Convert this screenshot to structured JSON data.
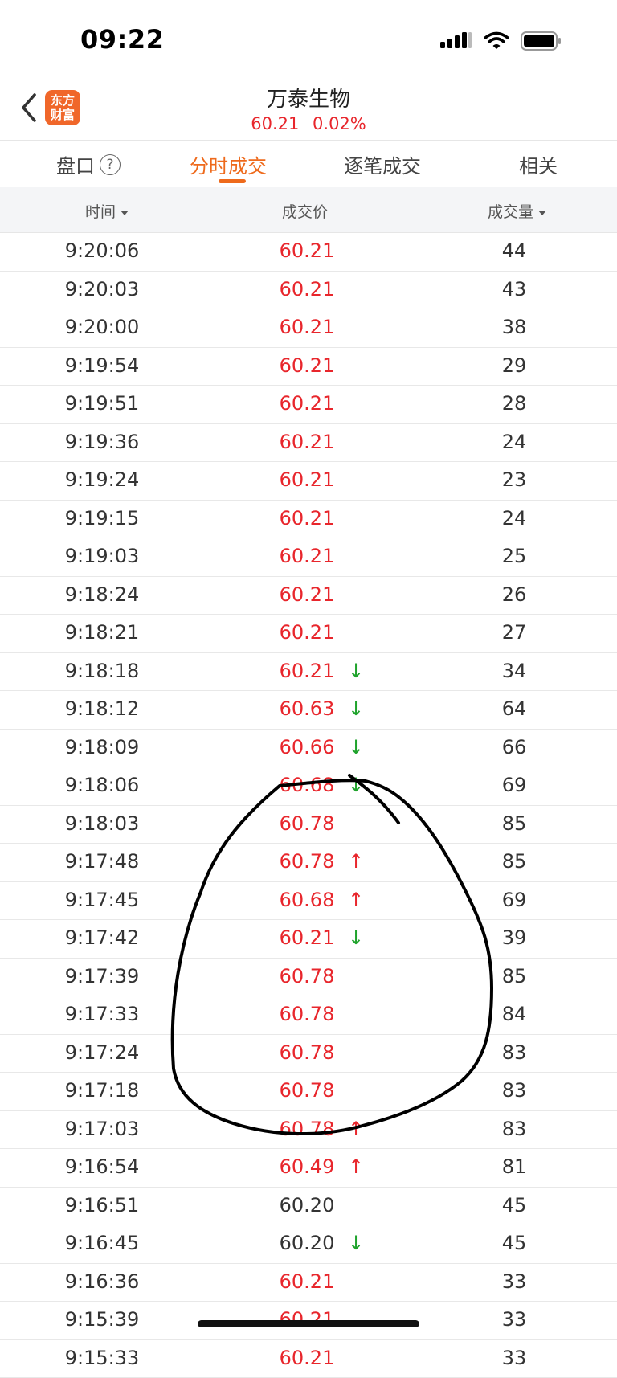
{
  "status": {
    "time": "09:22"
  },
  "header": {
    "logo_line1": "东方",
    "logo_line2": "财富",
    "title": "万泰生物",
    "price": "60.21",
    "change_pct": "0.02%"
  },
  "tabs": [
    {
      "label": "盘口",
      "has_help": true,
      "active": false
    },
    {
      "label": "分时成交",
      "active": true
    },
    {
      "label": "逐笔成交",
      "active": false
    },
    {
      "label": "相关",
      "active": false
    }
  ],
  "columns": {
    "time": "时间",
    "price": "成交价",
    "volume": "成交量"
  },
  "colors": {
    "up": "#e8262c",
    "down": "#1fa32c",
    "accent": "#ee6a1c"
  },
  "trades": [
    {
      "time": "9:20:06",
      "price": "60.21",
      "arrow": "",
      "volume": "44",
      "tone": "up"
    },
    {
      "time": "9:20:03",
      "price": "60.21",
      "arrow": "",
      "volume": "43",
      "tone": "up"
    },
    {
      "time": "9:20:00",
      "price": "60.21",
      "arrow": "",
      "volume": "38",
      "tone": "up"
    },
    {
      "time": "9:19:54",
      "price": "60.21",
      "arrow": "",
      "volume": "29",
      "tone": "up"
    },
    {
      "time": "9:19:51",
      "price": "60.21",
      "arrow": "",
      "volume": "28",
      "tone": "up"
    },
    {
      "time": "9:19:36",
      "price": "60.21",
      "arrow": "",
      "volume": "24",
      "tone": "up"
    },
    {
      "time": "9:19:24",
      "price": "60.21",
      "arrow": "",
      "volume": "23",
      "tone": "up"
    },
    {
      "time": "9:19:15",
      "price": "60.21",
      "arrow": "",
      "volume": "24",
      "tone": "up"
    },
    {
      "time": "9:19:03",
      "price": "60.21",
      "arrow": "",
      "volume": "25",
      "tone": "up"
    },
    {
      "time": "9:18:24",
      "price": "60.21",
      "arrow": "",
      "volume": "26",
      "tone": "up"
    },
    {
      "time": "9:18:21",
      "price": "60.21",
      "arrow": "",
      "volume": "27",
      "tone": "up"
    },
    {
      "time": "9:18:18",
      "price": "60.21",
      "arrow": "down",
      "volume": "34",
      "tone": "up"
    },
    {
      "time": "9:18:12",
      "price": "60.63",
      "arrow": "down",
      "volume": "64",
      "tone": "up"
    },
    {
      "time": "9:18:09",
      "price": "60.66",
      "arrow": "down",
      "volume": "66",
      "tone": "up"
    },
    {
      "time": "9:18:06",
      "price": "60.68",
      "arrow": "down",
      "volume": "69",
      "tone": "up"
    },
    {
      "time": "9:18:03",
      "price": "60.78",
      "arrow": "",
      "volume": "85",
      "tone": "up"
    },
    {
      "time": "9:17:48",
      "price": "60.78",
      "arrow": "up",
      "volume": "85",
      "tone": "up"
    },
    {
      "time": "9:17:45",
      "price": "60.68",
      "arrow": "up",
      "volume": "69",
      "tone": "up"
    },
    {
      "time": "9:17:42",
      "price": "60.21",
      "arrow": "down",
      "volume": "39",
      "tone": "up"
    },
    {
      "time": "9:17:39",
      "price": "60.78",
      "arrow": "",
      "volume": "85",
      "tone": "up"
    },
    {
      "time": "9:17:33",
      "price": "60.78",
      "arrow": "",
      "volume": "84",
      "tone": "up"
    },
    {
      "time": "9:17:24",
      "price": "60.78",
      "arrow": "",
      "volume": "83",
      "tone": "up"
    },
    {
      "time": "9:17:18",
      "price": "60.78",
      "arrow": "",
      "volume": "83",
      "tone": "up"
    },
    {
      "time": "9:17:03",
      "price": "60.78",
      "arrow": "up",
      "volume": "83",
      "tone": "up"
    },
    {
      "time": "9:16:54",
      "price": "60.49",
      "arrow": "up",
      "volume": "81",
      "tone": "up"
    },
    {
      "time": "9:16:51",
      "price": "60.20",
      "arrow": "",
      "volume": "45",
      "tone": "neutral"
    },
    {
      "time": "9:16:45",
      "price": "60.20",
      "arrow": "down",
      "volume": "45",
      "tone": "neutral"
    },
    {
      "time": "9:16:36",
      "price": "60.21",
      "arrow": "",
      "volume": "33",
      "tone": "up"
    },
    {
      "time": "9:15:39",
      "price": "60.21",
      "arrow": "",
      "volume": "33",
      "tone": "up"
    },
    {
      "time": "9:15:33",
      "price": "60.21",
      "arrow": "",
      "volume": "33",
      "tone": "up"
    }
  ]
}
